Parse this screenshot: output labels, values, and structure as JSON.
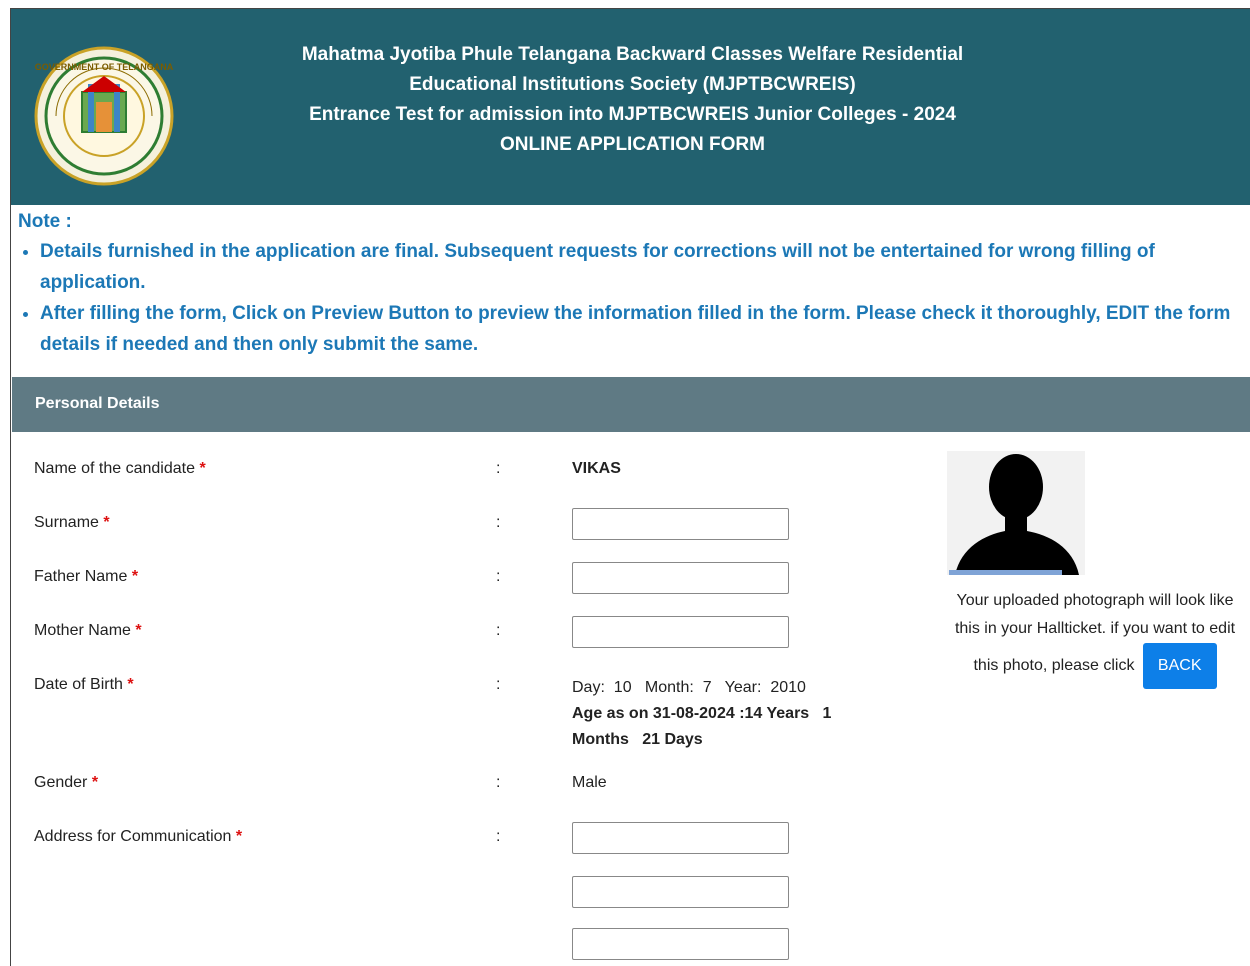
{
  "header": {
    "line1": "Mahatma Jyotiba Phule Telangana Backward Classes Welfare Residential",
    "line2": "Educational Institutions Society (MJPTBCWREIS)",
    "line3": "Entrance Test for admission into MJPTBCWREIS Junior Colleges - 2024",
    "line4": "ONLINE APPLICATION FORM",
    "logo_text": "GOVERNMENT OF TELANGANA"
  },
  "note": {
    "title": "Note :",
    "items": [
      "Details furnished in the application are final. Subsequent requests for corrections will not be entertained for wrong filling of application.",
      "After filling the form, Click on Preview Button to preview the information filled in the form. Please check it thoroughly, EDIT the form details if needed and then only submit the same."
    ]
  },
  "section": {
    "title": "Personal Details"
  },
  "form": {
    "colon": ":",
    "required_mark": "*",
    "name_label": "Name of the candidate",
    "name_value": "VIKAS",
    "surname_label": "Surname",
    "surname_value": "",
    "father_label": "Father Name",
    "father_value": "",
    "mother_label": "Mother Name",
    "mother_value": "",
    "dob_label": "Date of Birth",
    "dob_line": "Day:  10   Month:  7   Year:  2010",
    "age_line": "Age as on 31-08-2024 :14 Years   1 Months   21 Days",
    "gender_label": "Gender",
    "gender_value": "Male",
    "address_label": "Address for Communication",
    "address1": "",
    "address2": "",
    "address3": ""
  },
  "photo": {
    "caption_1": "Your uploaded photograph will look like this in your Hallticket. if you want to edit this photo, please click",
    "back_label": "BACK"
  },
  "colors": {
    "header_bg": "#22616f",
    "note_text": "#1c78b6",
    "section_bg": "#5f7a84",
    "button": "#0d7fe8"
  }
}
